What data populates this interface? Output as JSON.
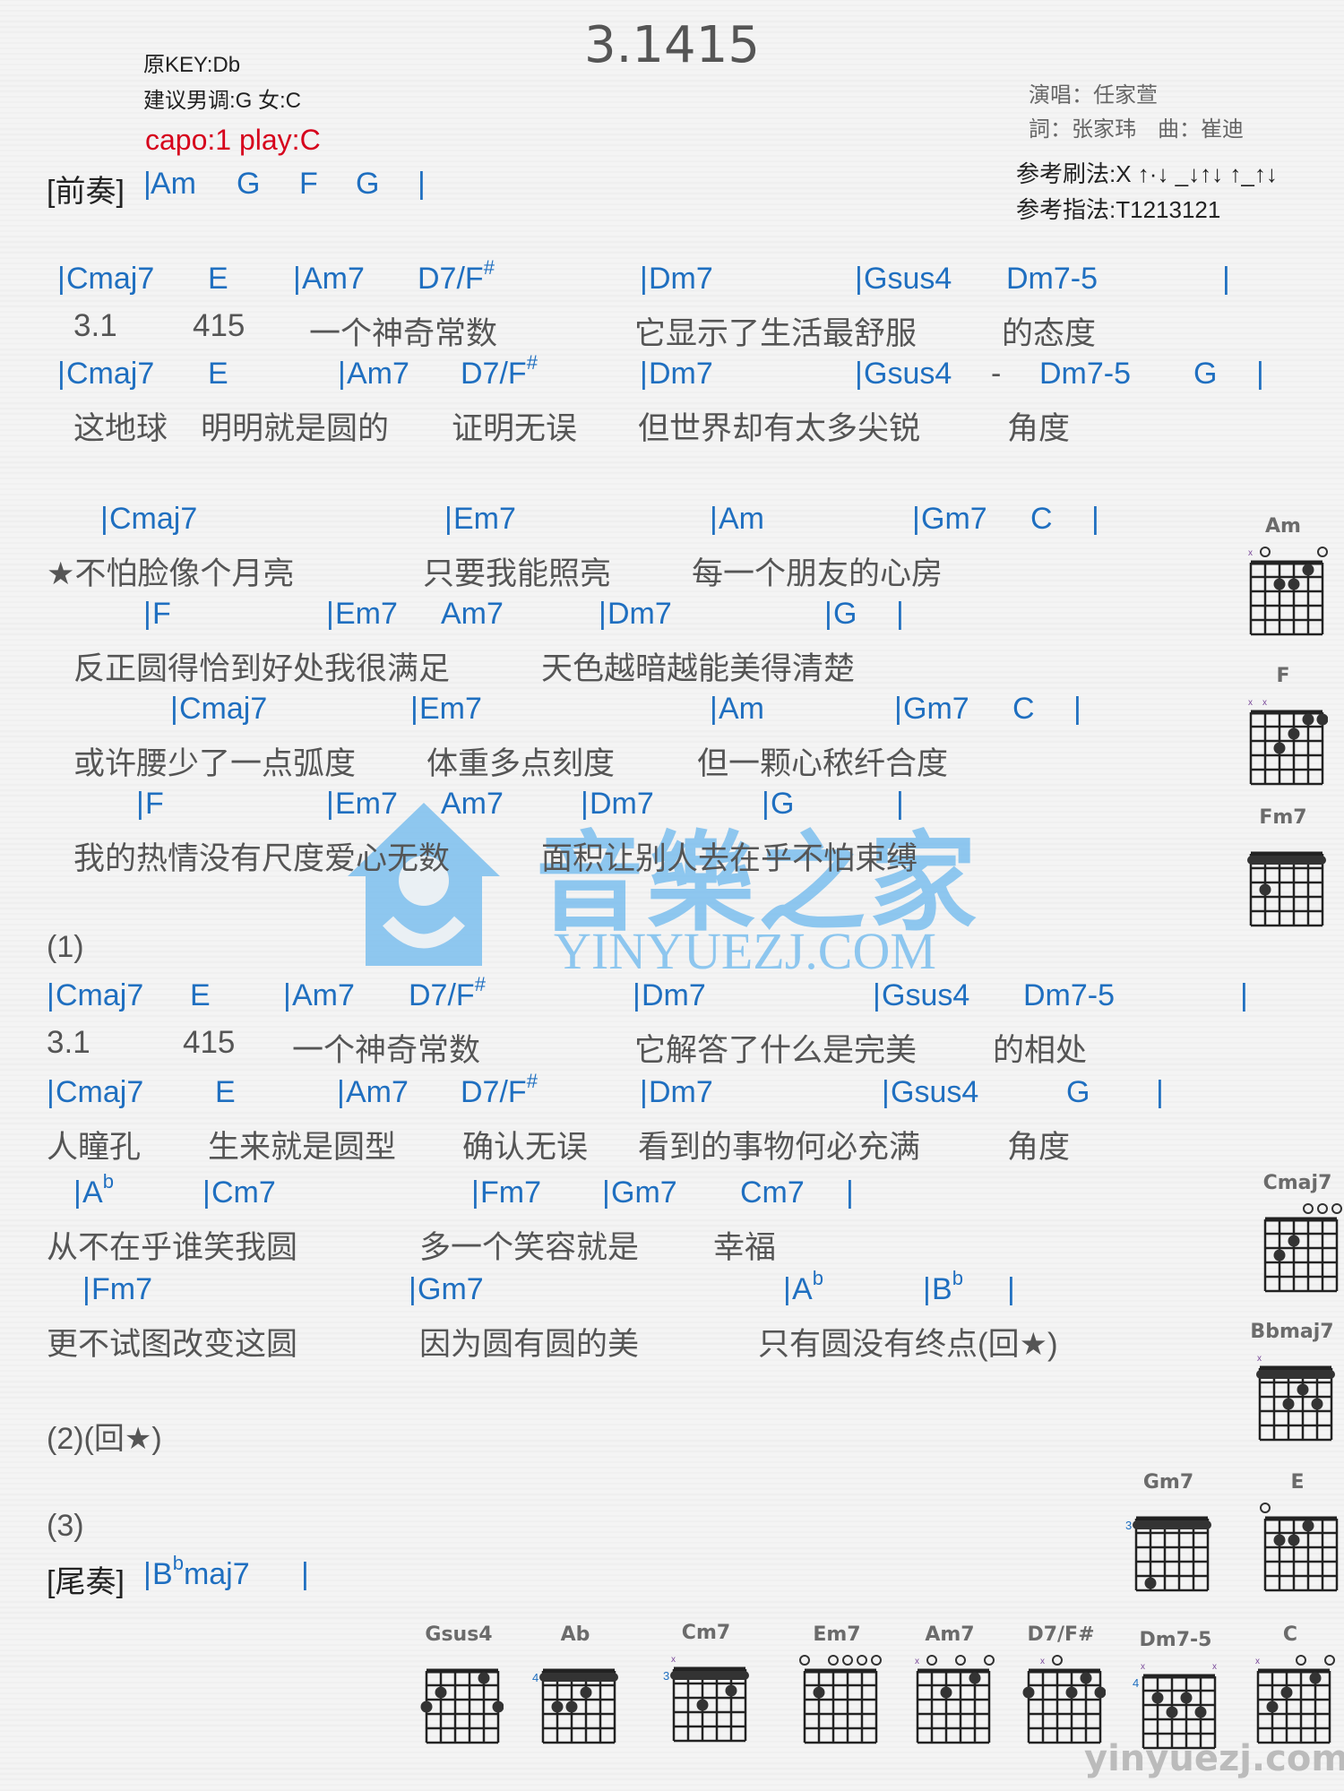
{
  "title": "3.1415",
  "meta": {
    "original_key": "原KEY:Db",
    "suggested_key": "建议男调:G 女:C",
    "capo": "capo:1 play:C",
    "singer": "演唱：任家萱",
    "writers": "詞：张家玮　曲：崔迪",
    "strum": "参考刷法:X ↑·↓ _↓↑↓ ↑_↑↓",
    "pick": "参考指法:T1213121"
  },
  "intro": {
    "label": "[前奏]",
    "chords": [
      "Am",
      "G",
      "F",
      "G"
    ]
  },
  "verse1": [
    {
      "chords": [
        "Cmaj7",
        "E",
        "Am7",
        "D7/F#",
        "Dm7",
        "Gsus4",
        "Dm7-5"
      ],
      "lyrics": [
        "3.1",
        "415",
        "一个神奇常数",
        "它显示了生活最舒服",
        "的态度"
      ]
    },
    {
      "chords": [
        "Cmaj7",
        "E",
        "Am7",
        "D7/F#",
        "Dm7",
        "Gsus4",
        "-",
        "Dm7-5",
        "G"
      ],
      "lyrics": [
        "这地球",
        "明明就是圆的",
        "证明无误",
        "但世界却有太多尖锐",
        "角度"
      ]
    }
  ],
  "chorus": [
    {
      "chords": [
        "Cmaj7",
        "Em7",
        "Am",
        "Gm7",
        "C"
      ],
      "lyrics": [
        "★不怕脸像个月亮",
        "只要我能照亮",
        "每一个朋友的心房"
      ]
    },
    {
      "chords": [
        "F",
        "Em7",
        "Am7",
        "Dm7",
        "G"
      ],
      "lyrics": [
        "反正圆得恰到好处我很满足",
        "天色越暗越能美得清楚"
      ]
    },
    {
      "chords": [
        "Cmaj7",
        "Em7",
        "Am",
        "Gm7",
        "C"
      ],
      "lyrics": [
        "或许腰少了一点弧度",
        "体重多点刻度",
        "但一颗心秾纤合度"
      ]
    },
    {
      "chords": [
        "F",
        "Em7",
        "Am7",
        "Dm7",
        "G"
      ],
      "lyrics": [
        "我的热情没有尺度爱心无数",
        "面积让别人去在乎不怕束缚"
      ]
    }
  ],
  "part1_label": "(1)",
  "verse2": [
    {
      "chords": [
        "Cmaj7",
        "E",
        "Am7",
        "D7/F#",
        "Dm7",
        "Gsus4",
        "Dm7-5"
      ],
      "lyrics": [
        "3.1",
        "415",
        "一个神奇常数",
        "它解答了什么是完美",
        "的相处"
      ]
    },
    {
      "chords": [
        "Cmaj7",
        "E",
        "Am7",
        "D7/F#",
        "Dm7",
        "Gsus4",
        "G"
      ],
      "lyrics": [
        "人瞳孔",
        "生来就是圆型",
        "确认无误",
        "看到的事物何必充满",
        "角度"
      ]
    }
  ],
  "bridge": [
    {
      "chords": [
        "Ab",
        "Cm7",
        "Fm7",
        "Gm7",
        "Cm7"
      ],
      "lyrics": [
        "从不在乎谁笑我圆",
        "多一个笑容就是",
        "幸福"
      ]
    },
    {
      "chords": [
        "Fm7",
        "Gm7",
        "Ab",
        "Bb"
      ],
      "lyrics": [
        "更不试图改变这圆",
        "因为圆有圆的美",
        "只有圆没有终点(回★)"
      ]
    }
  ],
  "part2_label": "(2)(回★)",
  "part3_label": "(3)",
  "outro": {
    "label": "[尾奏]",
    "chord": "Bbmaj7"
  },
  "watermark": {
    "cn": "音樂之家",
    "en": "YINYUEZJ.COM",
    "small_en": "yinyuezj.com"
  },
  "chord_diagrams": [
    {
      "name": "Am",
      "strings": [
        "x",
        "o",
        "",
        "",
        "",
        "o"
      ],
      "frets": [
        [
          4,
          2
        ],
        [
          3,
          2
        ],
        [
          2,
          1
        ]
      ],
      "barre": null,
      "fret_start": null
    },
    {
      "name": "F",
      "strings": [
        "x",
        "x",
        "",
        "",
        "",
        ""
      ],
      "frets": [
        [
          4,
          3
        ],
        [
          3,
          2
        ],
        [
          2,
          1
        ],
        [
          1,
          1
        ]
      ],
      "barre": null,
      "fret_start": null
    },
    {
      "name": "Fm7",
      "strings": [
        "",
        "",
        "",
        "",
        "",
        ""
      ],
      "frets": [
        [
          5,
          3
        ]
      ],
      "barre": 1,
      "fret_start": null
    },
    {
      "name": "Cmaj7",
      "strings": [
        "",
        "",
        "",
        "o",
        "o",
        "o"
      ],
      "frets": [
        [
          5,
          3
        ],
        [
          4,
          2
        ]
      ],
      "barre": null,
      "fret_start": null
    },
    {
      "name": "Bbmaj7",
      "strings": [
        "x",
        "",
        "",
        "",
        "",
        ""
      ],
      "frets": [
        [
          3,
          2
        ],
        [
          4,
          3
        ],
        [
          2,
          3
        ]
      ],
      "barre": 1,
      "fret_start": null
    },
    {
      "name": "Gm7",
      "strings": [
        "",
        "",
        "",
        "",
        "",
        ""
      ],
      "frets": [
        [
          5,
          5
        ]
      ],
      "barre": 1,
      "fret_start": "3"
    },
    {
      "name": "E",
      "strings": [
        "o",
        "",
        "",
        "",
        "",
        ""
      ],
      "frets": [
        [
          5,
          2
        ],
        [
          4,
          2
        ],
        [
          3,
          1
        ]
      ],
      "barre": null,
      "fret_start": null
    },
    {
      "name": "Gsus4",
      "strings": [
        "",
        "",
        "",
        "",
        "",
        ""
      ],
      "frets": [
        [
          6,
          3
        ],
        [
          5,
          2
        ],
        [
          2,
          1
        ],
        [
          1,
          3
        ]
      ],
      "barre": null,
      "fret_start": null
    },
    {
      "name": "Ab",
      "strings": [
        "",
        "",
        "",
        "",
        "",
        ""
      ],
      "frets": [
        [
          5,
          3
        ],
        [
          4,
          3
        ],
        [
          3,
          2
        ]
      ],
      "barre": 1,
      "fret_start": "4"
    },
    {
      "name": "Cm7",
      "strings": [
        "x",
        "",
        "",
        "",
        "",
        ""
      ],
      "frets": [
        [
          4,
          3
        ],
        [
          2,
          2
        ]
      ],
      "barre": 1,
      "fret_start": "3"
    },
    {
      "name": "Em7",
      "strings": [
        "o",
        "",
        "o",
        "o",
        "o",
        "o"
      ],
      "frets": [
        [
          5,
          2
        ]
      ],
      "barre": null,
      "fret_start": null
    },
    {
      "name": "Am7",
      "strings": [
        "x",
        "o",
        "",
        "o",
        "",
        "o"
      ],
      "frets": [
        [
          4,
          2
        ],
        [
          2,
          1
        ]
      ],
      "barre": null,
      "fret_start": null
    },
    {
      "name": "D7/F#",
      "strings": [
        "",
        "x",
        "o",
        "",
        "",
        ""
      ],
      "frets": [
        [
          6,
          2
        ],
        [
          3,
          2
        ],
        [
          2,
          1
        ],
        [
          1,
          2
        ]
      ],
      "barre": null,
      "fret_start": null
    },
    {
      "name": "Dm7-5",
      "strings": [
        "x",
        "",
        "",
        "",
        "",
        "x"
      ],
      "frets": [
        [
          5,
          2
        ],
        [
          3,
          2
        ],
        [
          4,
          3
        ],
        [
          2,
          3
        ]
      ],
      "barre": null,
      "fret_start": "4"
    },
    {
      "name": "C",
      "strings": [
        "x",
        "",
        "",
        "o",
        "",
        "o"
      ],
      "frets": [
        [
          5,
          3
        ],
        [
          4,
          2
        ],
        [
          2,
          1
        ]
      ],
      "barre": null,
      "fret_start": null
    }
  ]
}
